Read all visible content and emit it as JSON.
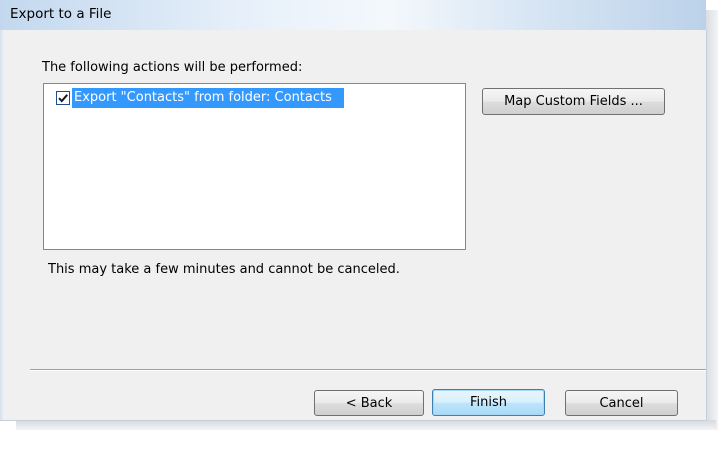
{
  "window": {
    "title": "Export to a File"
  },
  "main": {
    "actions_label": "The following actions will be performed:",
    "actions": [
      {
        "checked": true,
        "label": "Export \"Contacts\" from folder: Contacts"
      }
    ],
    "map_button_label": "Map Custom Fields ...",
    "note": "This may take a few minutes and cannot be canceled."
  },
  "footer": {
    "back_label": "< Back",
    "finish_label": "Finish",
    "cancel_label": "Cancel"
  },
  "colors": {
    "selection": "#3399ff",
    "dialog_background": "#f0f0f0",
    "title_bar": "#d8e6f4"
  },
  "icons": {
    "checkbox_checked": "check-icon"
  }
}
